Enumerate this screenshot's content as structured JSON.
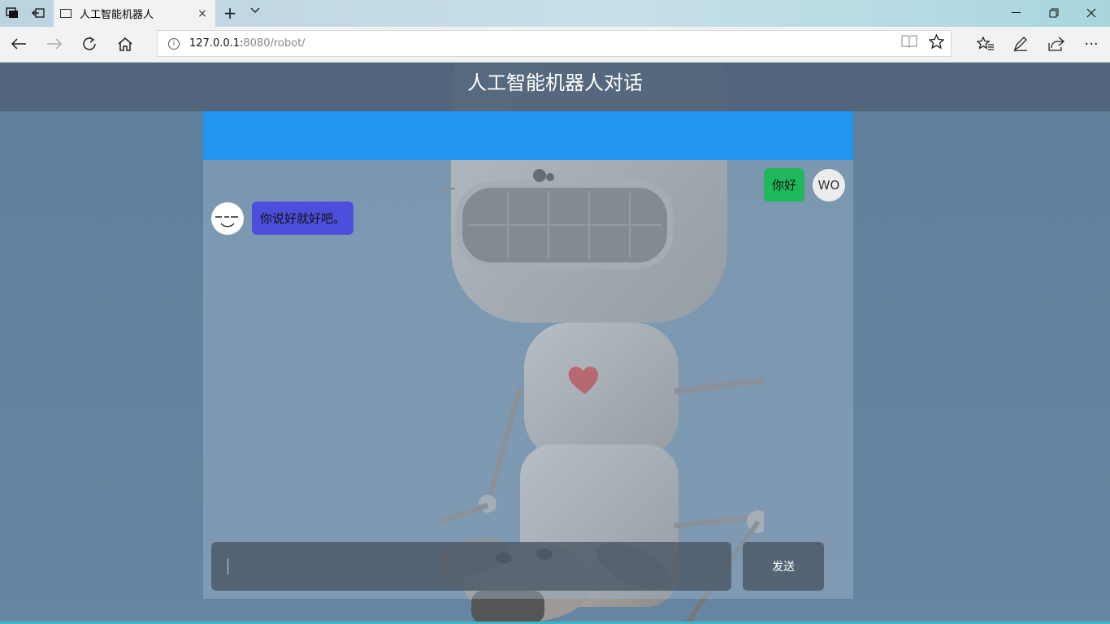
{
  "browser": {
    "tab": {
      "title": "人工智能机器人",
      "close_icon": "×"
    },
    "new_tab_icon": "+",
    "tab_menu_icon": "⌄",
    "window": {
      "minimize": "─",
      "restore": "❐",
      "close": "✕"
    },
    "nav": {
      "back": "←",
      "forward": "→",
      "refresh": "↻",
      "home": "⌂"
    },
    "address": {
      "host": "127.0.0.1:",
      "rest": "8080/robot/"
    },
    "address_icons": {
      "reading_view": "📖",
      "favorite": "☆"
    },
    "tools": {
      "favorites": "☆",
      "notes": "✎",
      "share": "⇪",
      "more": "···"
    }
  },
  "page": {
    "title": "人工智能机器人对话",
    "chat": {
      "messages": [
        {
          "sender": "user",
          "avatar": "WO",
          "text": "你好"
        },
        {
          "sender": "robot",
          "text": "你说好就好吧。"
        }
      ],
      "input": {
        "value": ""
      },
      "send_label": "发送"
    },
    "colors": {
      "header_bar": "#2196f3",
      "user_bubble": "#1fb95b",
      "robot_bubble": "#4b4fdc"
    }
  }
}
